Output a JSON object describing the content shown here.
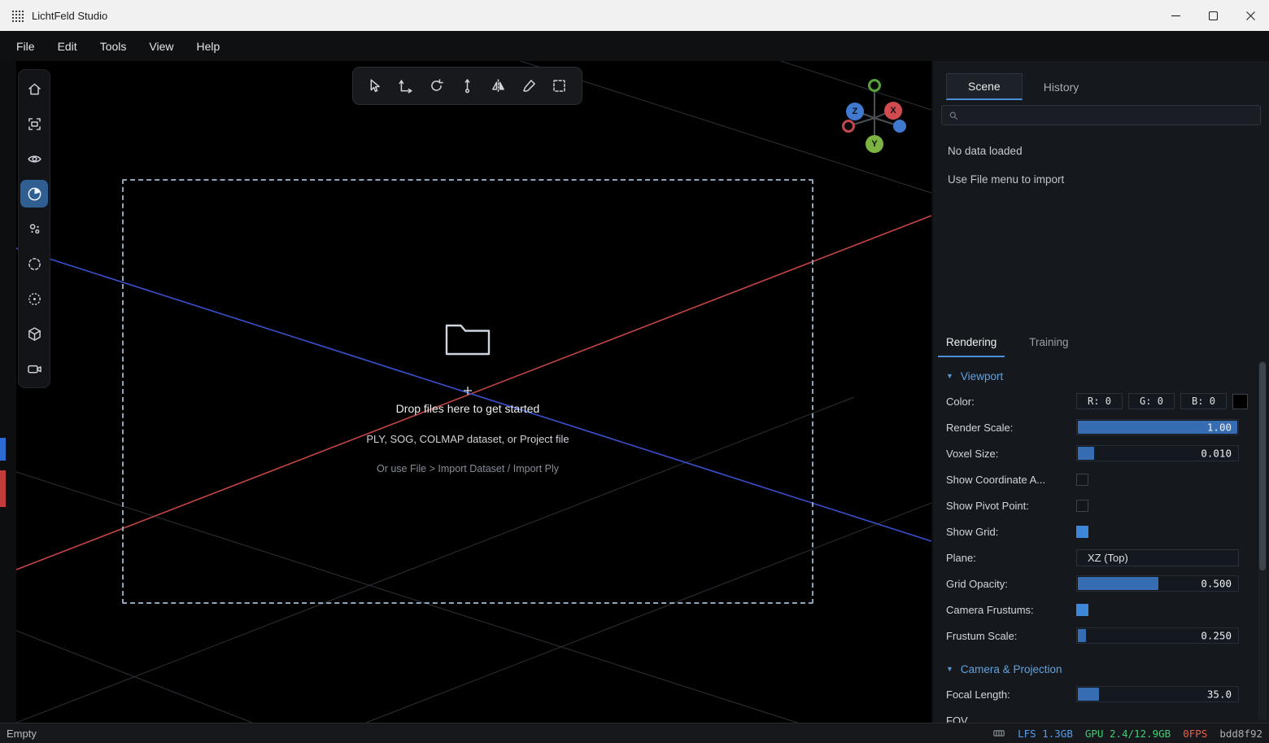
{
  "window": {
    "title": "LichtFeld Studio"
  },
  "menubar": {
    "items": [
      "File",
      "Edit",
      "Tools",
      "View",
      "Help"
    ]
  },
  "left_toolbar": {
    "items": [
      {
        "icon": "home-icon",
        "active": false
      },
      {
        "icon": "focus-frame-icon",
        "active": false
      },
      {
        "icon": "eye-icon",
        "active": false
      },
      {
        "icon": "pie-chart-icon",
        "active": true
      },
      {
        "icon": "points-cluster-icon",
        "active": false
      },
      {
        "icon": "dashed-circle-icon",
        "active": false
      },
      {
        "icon": "dotted-circle-icon",
        "active": false
      },
      {
        "icon": "cube-icon",
        "active": false
      },
      {
        "icon": "video-camera-icon",
        "active": false
      }
    ]
  },
  "top_toolbar": {
    "tools": [
      {
        "icon": "select-cursor-icon"
      },
      {
        "icon": "translate-icon"
      },
      {
        "icon": "rotate-icon"
      },
      {
        "icon": "axis-pivot-icon"
      },
      {
        "icon": "mirror-icon"
      },
      {
        "icon": "brush-icon"
      },
      {
        "icon": "marquee-select-icon"
      }
    ]
  },
  "viewport": {
    "dropzone": {
      "title": "Drop files here to get started",
      "subtitle": "PLY, SOG, COLMAP dataset, or Project file",
      "hint": "Or use File > Import Dataset / Import Ply"
    },
    "gizmo": {
      "x": "X",
      "y": "Y",
      "z": "Z"
    }
  },
  "right_panel": {
    "scene_tabs": [
      {
        "label": "Scene",
        "active": true
      },
      {
        "label": "History",
        "active": false
      }
    ],
    "search": {
      "placeholder": ""
    },
    "empty_state": {
      "line1": "No data loaded",
      "line2": "Use File menu to import"
    },
    "property_tabs": [
      {
        "label": "Rendering",
        "active": true
      },
      {
        "label": "Training",
        "active": false
      }
    ],
    "section_collapse_glyph": "▼",
    "sections": [
      {
        "title": "Viewport",
        "rows": [
          {
            "label": "Color:",
            "type": "rgb",
            "r": "R: 0",
            "g": "G: 0",
            "b": "B: 0",
            "swatch": "#000000"
          },
          {
            "label": "Render Scale:",
            "type": "slider",
            "value": "1.00",
            "fraction": 1
          },
          {
            "label": "Voxel Size:",
            "type": "slider",
            "value": "0.010",
            "fraction": 0.1
          },
          {
            "label": "Show Coordinate A...",
            "type": "checkbox",
            "checked": false
          },
          {
            "label": "Show Pivot Point:",
            "type": "checkbox",
            "checked": false
          },
          {
            "label": "Show Grid:",
            "type": "checkbox",
            "checked": true
          },
          {
            "label": "Plane:",
            "type": "select",
            "value": "XZ (Top)"
          },
          {
            "label": "Grid Opacity:",
            "type": "slider",
            "value": "0.500",
            "fraction": 0.5
          },
          {
            "label": "Camera Frustums:",
            "type": "checkbox",
            "checked": true
          },
          {
            "label": "Frustum Scale:",
            "type": "slider",
            "value": "0.250",
            "fraction": 0.05
          }
        ]
      },
      {
        "title": "Camera & Projection",
        "rows": [
          {
            "label": "Focal Length:",
            "type": "slider",
            "value": "35.0",
            "fraction": 0.13
          },
          {
            "label": "FOV",
            "type": "clipped"
          }
        ]
      }
    ]
  },
  "statusbar": {
    "left": "Empty",
    "lfs": "LFS 1.3GB",
    "gpu": "GPU 2.4/12.9GB",
    "fps": "0FPS",
    "hash": "bdd8f92"
  },
  "colors": {
    "accent": "#4a8fd8",
    "slider_fill": "#356cb2",
    "axis_x_red": "#c24545",
    "axis_z_blue": "#3c50cc",
    "status_lfs": "#4da0f5",
    "status_gpu": "#3ecf76",
    "status_fps": "#e8604c"
  }
}
